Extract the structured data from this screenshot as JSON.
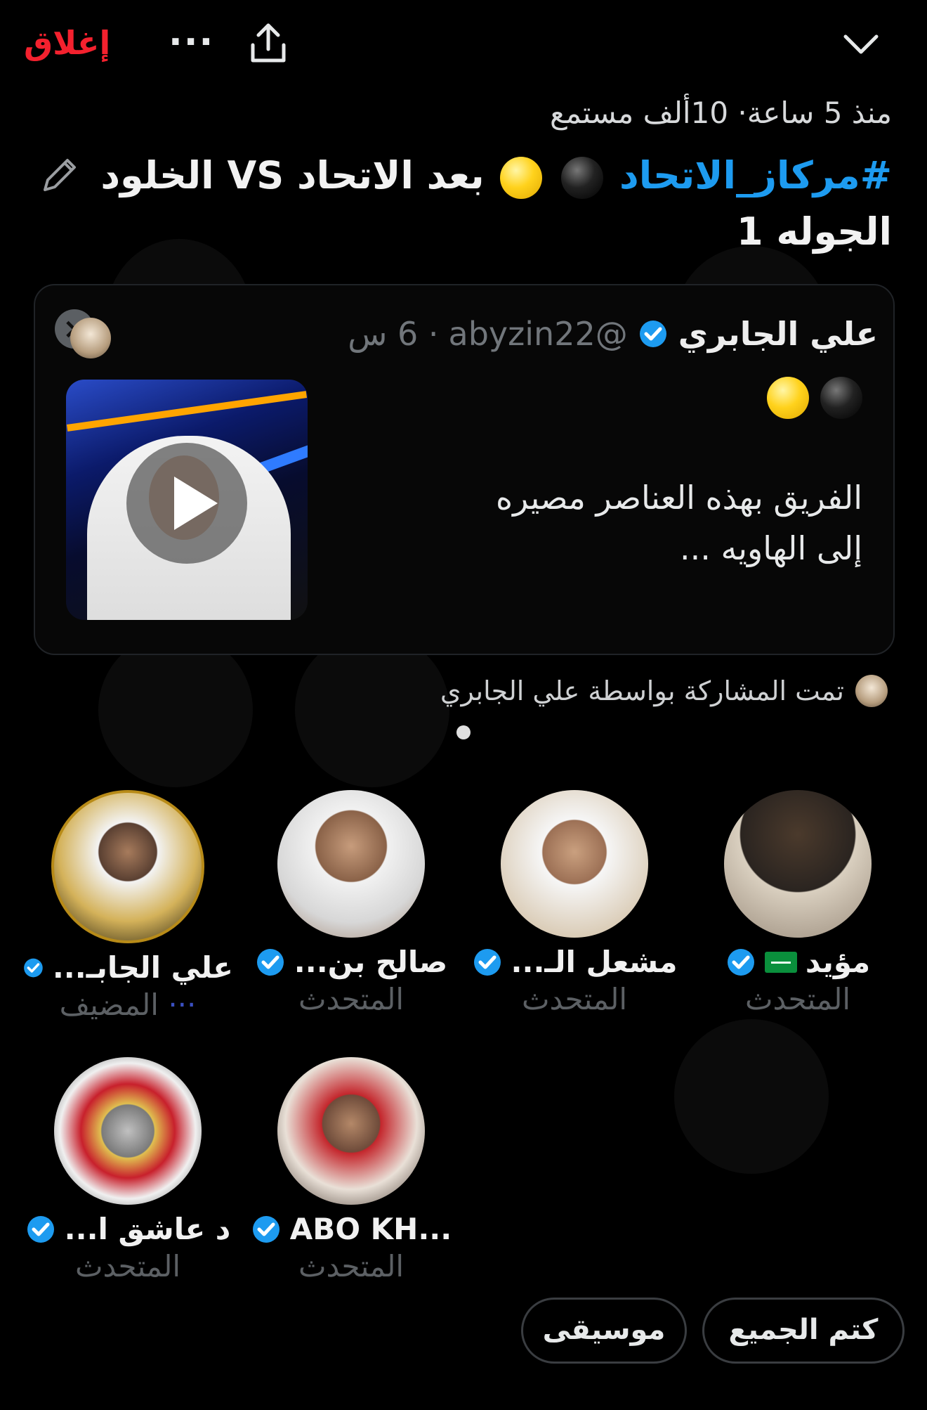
{
  "header": {
    "close_label": "إغلاق",
    "more_icon": "ellipsis-icon",
    "share_icon": "share-upload-icon",
    "collapse_icon": "chevron-down-icon"
  },
  "space": {
    "meta": "منذ 5 ساعة· 10ألف مستمع",
    "title_hashtag": "#مركاز_الاتحاد",
    "title_rest": "بعد الاتحاد VS الخلود",
    "title_line2": "الجوله 1"
  },
  "pinned_post": {
    "author_name": "علي الجابري",
    "handle": "@abyzin22",
    "time": "· 6 س",
    "text": "الفريق بهذه العناصر مصيره إلى الهاويه ..."
  },
  "shared_by": "تمت المشاركة بواسطة علي الجابري",
  "speakers": [
    {
      "name": "علي الجابـ...",
      "role": "المضيف",
      "role_prefix": "···"
    },
    {
      "name": "صالح بن...",
      "role": "المتحدث"
    },
    {
      "name": "مشعل الـ...",
      "role": "المتحدث"
    },
    {
      "name": "مؤيد",
      "role": "المتحدث"
    },
    {
      "name": "د عاشق ا...",
      "role": "المتحدث"
    },
    {
      "name": "ABO KH...",
      "role": "المتحدث"
    }
  ],
  "actions": {
    "mute_all": "كتم الجميع",
    "music": "موسيقى"
  },
  "colors": {
    "accent": "#1d9bf0",
    "close": "#f4212e",
    "background": "#000000"
  }
}
